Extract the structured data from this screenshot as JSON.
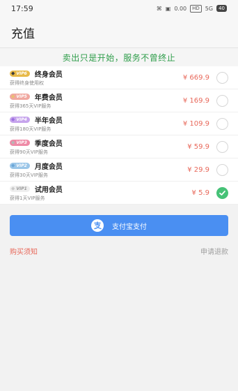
{
  "status_bar": {
    "time": "17:59",
    "net_speed": "0.00",
    "signal": "5G",
    "battery": "40"
  },
  "header": {
    "title": "充值"
  },
  "slogan": "卖出只是开始，服务不曾终止",
  "plans": [
    {
      "badge": "VIP6",
      "badge_color": "#e7b949",
      "gem_color": "#3a3a3a",
      "name": "终身会员",
      "desc": "获得终身使用权",
      "price": "¥ 669.9",
      "selected": false
    },
    {
      "badge": "VIP5",
      "badge_color": "#f0a8a0",
      "gem_color": "#e8c070",
      "name": "年费会员",
      "desc": "获得365天VIP服务",
      "price": "¥ 169.9",
      "selected": false
    },
    {
      "badge": "VIP4",
      "badge_color": "#c6a4ec",
      "gem_color": "#9c6fe0",
      "name": "半年会员",
      "desc": "获得180天VIP服务",
      "price": "¥ 109.9",
      "selected": false
    },
    {
      "badge": "VIP3",
      "badge_color": "#ee8aa6",
      "gem_color": "#b6b6b6",
      "name": "季度会员",
      "desc": "获得90天VIP服务",
      "price": "¥ 59.9",
      "selected": false
    },
    {
      "badge": "VIP2",
      "badge_color": "#9bc6e8",
      "gem_color": "#6aa6d8",
      "name": "月度会员",
      "desc": "获得30天VIP服务",
      "price": "¥ 29.9",
      "selected": false
    },
    {
      "badge": "VIP1",
      "badge_color": "#eeeeee",
      "gem_color": "#c9c9c9",
      "badge_text_color": "#999999",
      "name": "试用会员",
      "desc": "获得1天VIP服务",
      "price": "¥ 5.9",
      "selected": true
    }
  ],
  "pay_button": {
    "label": "支付宝支付",
    "icon": "alipay-icon"
  },
  "links": {
    "purchase_notice": "购买须知",
    "refund": "申请退款"
  },
  "colors": {
    "accent_green": "#46c277",
    "slogan_green": "#2e9d4a",
    "price_red": "#e8685a",
    "pay_blue": "#4a8ff2"
  }
}
